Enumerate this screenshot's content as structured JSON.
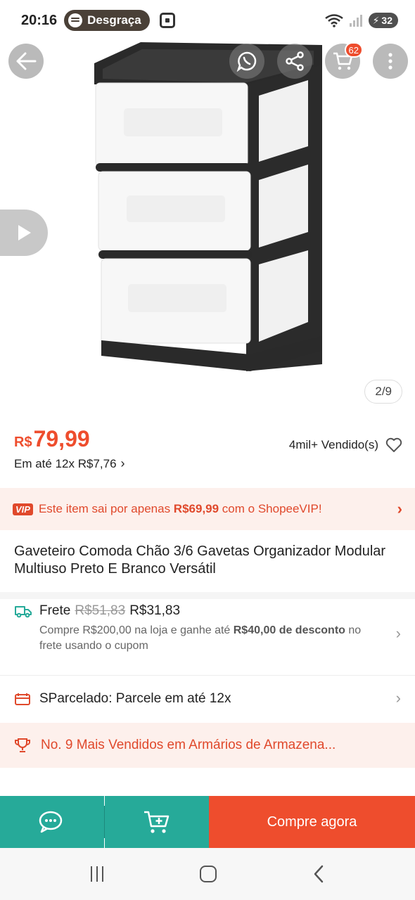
{
  "status_bar": {
    "time": "20:16",
    "spotify_label": "Desgraça",
    "battery": "32"
  },
  "product_image": {
    "counter": "2/9",
    "cart_badge": "62"
  },
  "price": {
    "currency": "R$",
    "value": "79,99",
    "installments": "Em até 12x R$7,76",
    "sold": "4mil+ Vendido(s)"
  },
  "vip": {
    "badge": "VIP",
    "text_before": "Este item sai por apenas ",
    "price": "R$69,99",
    "text_after": " com o ShopeeVIP!"
  },
  "title": "Gaveteiro Comoda Chão 3/6 Gavetas Organizador Modular  Multiuso Preto E Branco Versátil",
  "shipping": {
    "label": "Frete",
    "old_price": "R$51,83",
    "new_price": "R$31,83",
    "sub_before": "Compre R$200,00 na loja e ganhe até ",
    "sub_bold": "R$40,00 de desconto",
    "sub_after": " no frete usando o cupom"
  },
  "sparcelado": "SParcelado: Parcele em até 12x",
  "ranking": "No. 9 Mais Vendidos em Armários de Armazena...",
  "actions": {
    "buy_label": "Compre agora"
  },
  "colors": {
    "shopee_orange": "#ee4d2d",
    "teal": "#26aa99",
    "vip_bg": "#fdf0ec"
  }
}
